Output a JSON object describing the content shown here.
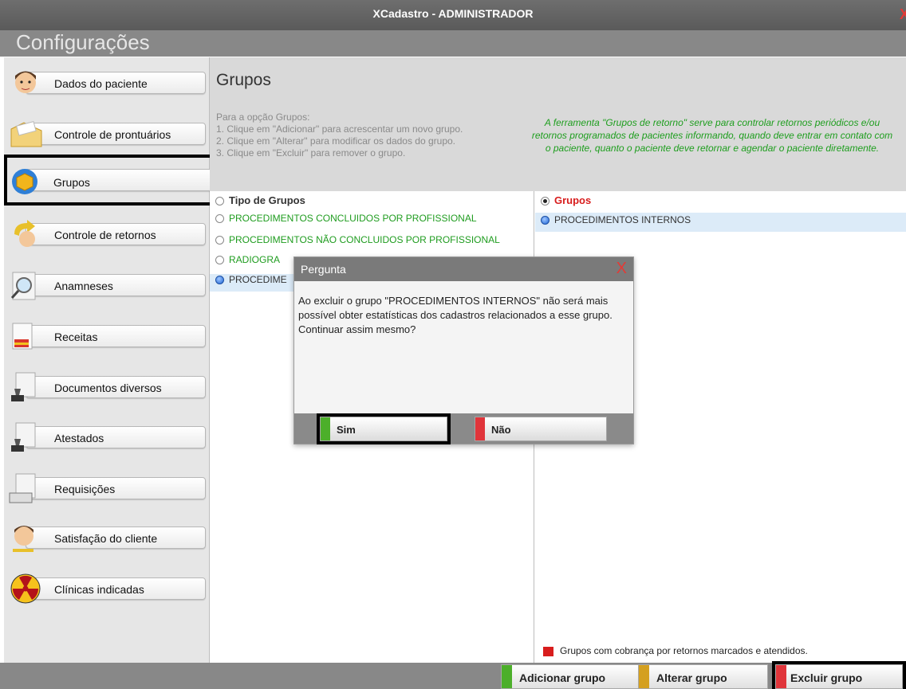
{
  "window": {
    "title": "XCadastro - ADMINISTRADOR",
    "close_glyph": "X"
  },
  "header": {
    "title": "Configurações"
  },
  "sidebar": {
    "items": [
      {
        "label": "Dados do paciente",
        "icon": "doctor-avatar-icon"
      },
      {
        "label": "Controle de prontuários",
        "icon": "folder-icon"
      },
      {
        "label": "Grupos",
        "icon": "cube-icon",
        "selected": true
      },
      {
        "label": "Controle de retornos",
        "icon": "return-arrow-icon"
      },
      {
        "label": "Anamneses",
        "icon": "magnifier-icon"
      },
      {
        "label": "Receitas",
        "icon": "prescription-icon"
      },
      {
        "label": "Documentos diversos",
        "icon": "stamp-icon"
      },
      {
        "label": "Atestados",
        "icon": "stamp-icon"
      },
      {
        "label": "Requisições",
        "icon": "document-icon"
      },
      {
        "label": "Satisfação do cliente",
        "icon": "person-icon"
      },
      {
        "label": "Clínicas indicadas",
        "icon": "radiation-icon"
      }
    ]
  },
  "section": {
    "title": "Grupos",
    "steps": [
      "Para a opção Grupos:",
      "1. Clique em \"Adicionar\" para acrescentar um novo grupo.",
      "2. Clique em \"Alterar\" para modificar os dados do grupo.",
      "3. Clique em \"Excluir\" para remover o grupo."
    ],
    "info": "A ferramenta \"Grupos de retorno\" serve para controlar retornos periódicos e/ou retornos programados de pacientes informando, quando deve entrar em contato com o paciente, quanto o paciente deve retornar e agendar o paciente diretamente."
  },
  "left_list": {
    "header": "Tipo de Grupos",
    "items": [
      "PROCEDIMENTOS CONCLUIDOS POR PROFISSIONAL",
      "PROCEDIMENTOS NÃO CONCLUIDOS POR PROFISSIONAL",
      "RADIOGRA",
      "PROCEDIME"
    ]
  },
  "right_list": {
    "header": "Grupos",
    "items": [
      "PROCEDIMENTOS INTERNOS"
    ]
  },
  "legend": {
    "text": "Grupos com cobrança por retornos marcados e atendidos.",
    "color": "#d81d1d"
  },
  "footer": {
    "add_label": "Adicionar grupo",
    "edit_label": "Alterar grupo",
    "delete_label": "Excluir grupo",
    "colors": {
      "add": "#4caf2a",
      "edit": "#d4a020",
      "delete": "#e0343a"
    }
  },
  "dialog": {
    "title": "Pergunta",
    "close_glyph": "X",
    "message": "Ao excluir o grupo \"PROCEDIMENTOS INTERNOS\" não será mais possível obter estatísticas dos cadastros relacionados a esse grupo. Continuar assim mesmo?",
    "yes_label": "Sim",
    "no_label": "Não"
  }
}
